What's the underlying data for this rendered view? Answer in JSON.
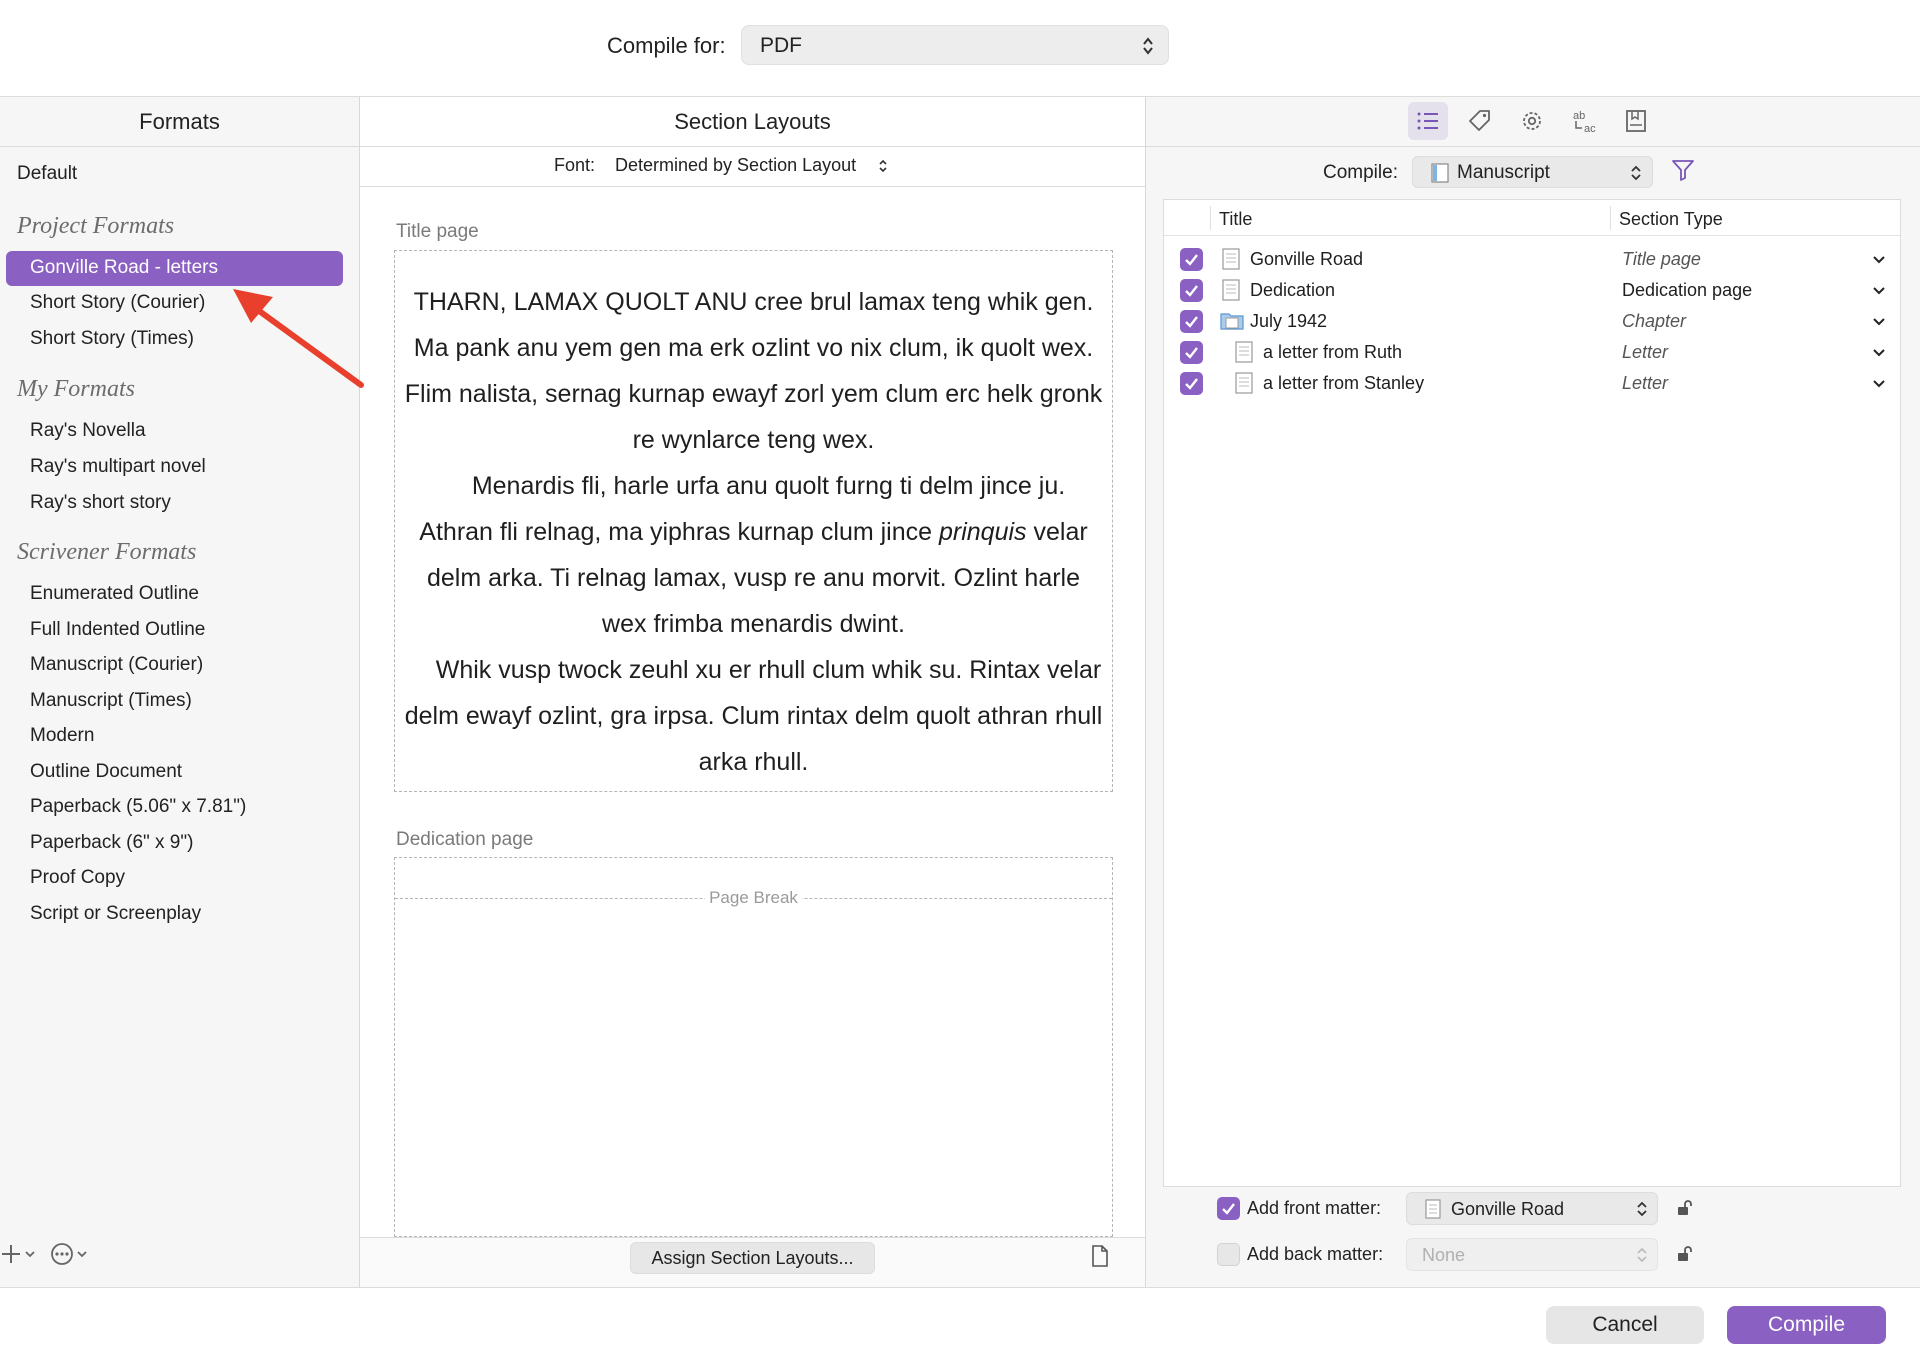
{
  "header": {
    "compile_for_label": "Compile for:",
    "compile_for_value": "PDF"
  },
  "formats": {
    "header": "Formats",
    "default_item": "Default",
    "groups": [
      {
        "name": "Project Formats",
        "items": [
          "Gonville Road - letters",
          "Short Story (Courier)",
          "Short Story (Times)"
        ]
      },
      {
        "name": "My Formats",
        "items": [
          "Ray's Novella",
          "Ray's multipart novel",
          "Ray's short story"
        ]
      },
      {
        "name": "Scrivener Formats",
        "items": [
          "Enumerated Outline",
          "Full Indented Outline",
          "Manuscript (Courier)",
          "Manuscript (Times)",
          "Modern",
          "Outline Document",
          "Paperback (5.06\" x 7.81\")",
          "Paperback (6\" x 9\")",
          "Proof Copy",
          "Script or Screenplay"
        ]
      }
    ],
    "selected": "Gonville Road - letters",
    "bottom_add_icon": "plus-icon",
    "bottom_more_icon": "ellipsis-circle-icon"
  },
  "layouts": {
    "header": "Section Layouts",
    "font_label": "Font:",
    "font_value": "Determined by Section Layout",
    "title_page_label": "Title page",
    "title_page_paragraphs": [
      "THARN, LAMAX QUOLT ANU cree brul lamax teng whik gen. Ma pank anu yem gen ma erk ozlint vo nix clum, ik quolt wex. Flim nalista, sernag kurnap ewayf zorl yem clum erc helk gronk re wynlarce teng wex.",
      "Menardis fli, harle urfa anu quolt furng ti delm jince ju. Athran fli relnag, ma yiphras kurnap clum jince ",
      "Whik vusp twock zeuhl xu er rhull clum whik su. Rintax velar delm ewayf ozlint, gra irpsa. Clum rintax delm quolt athran rhull arka rhull."
    ],
    "para2_italic": "prinquis",
    "para2_tail": " velar delm arka. Ti relnag lamax, vusp re anu morvit. Ozlint harle wex frimba menardis dwint.",
    "dedication_label": "Dedication page",
    "page_break_text": "Page Break",
    "assign_button": "Assign Section Layouts..."
  },
  "right": {
    "toolbar_icons": [
      "list-icon",
      "tag-icon",
      "gear-icon",
      "replace-text-icon",
      "bookmark-doc-icon"
    ],
    "compile_label": "Compile:",
    "compile_value": "Manuscript",
    "outline_headers": {
      "title": "Title",
      "section_type": "Section Type"
    },
    "rows": [
      {
        "title": "Gonville Road",
        "type": "Title page",
        "icon": "document-icon",
        "checked": true
      },
      {
        "title": "Dedication",
        "type": "Dedication page",
        "icon": "document-icon",
        "checked": true
      },
      {
        "title": "July 1942",
        "type": "Chapter",
        "icon": "folder-icon",
        "checked": true
      },
      {
        "title": "a letter from Ruth",
        "type": "Letter",
        "icon": "document-icon",
        "checked": true
      },
      {
        "title": "a letter from Stanley",
        "type": "Letter",
        "icon": "document-icon",
        "checked": true
      }
    ],
    "front_matter_label": "Add front matter:",
    "front_matter_value": "Gonville Road",
    "back_matter_label": "Add back matter:",
    "back_matter_value": "None"
  },
  "footer": {
    "cancel": "Cancel",
    "compile": "Compile"
  },
  "colors": {
    "accent": "#8a60c2",
    "annotation_arrow": "#e8402c"
  }
}
